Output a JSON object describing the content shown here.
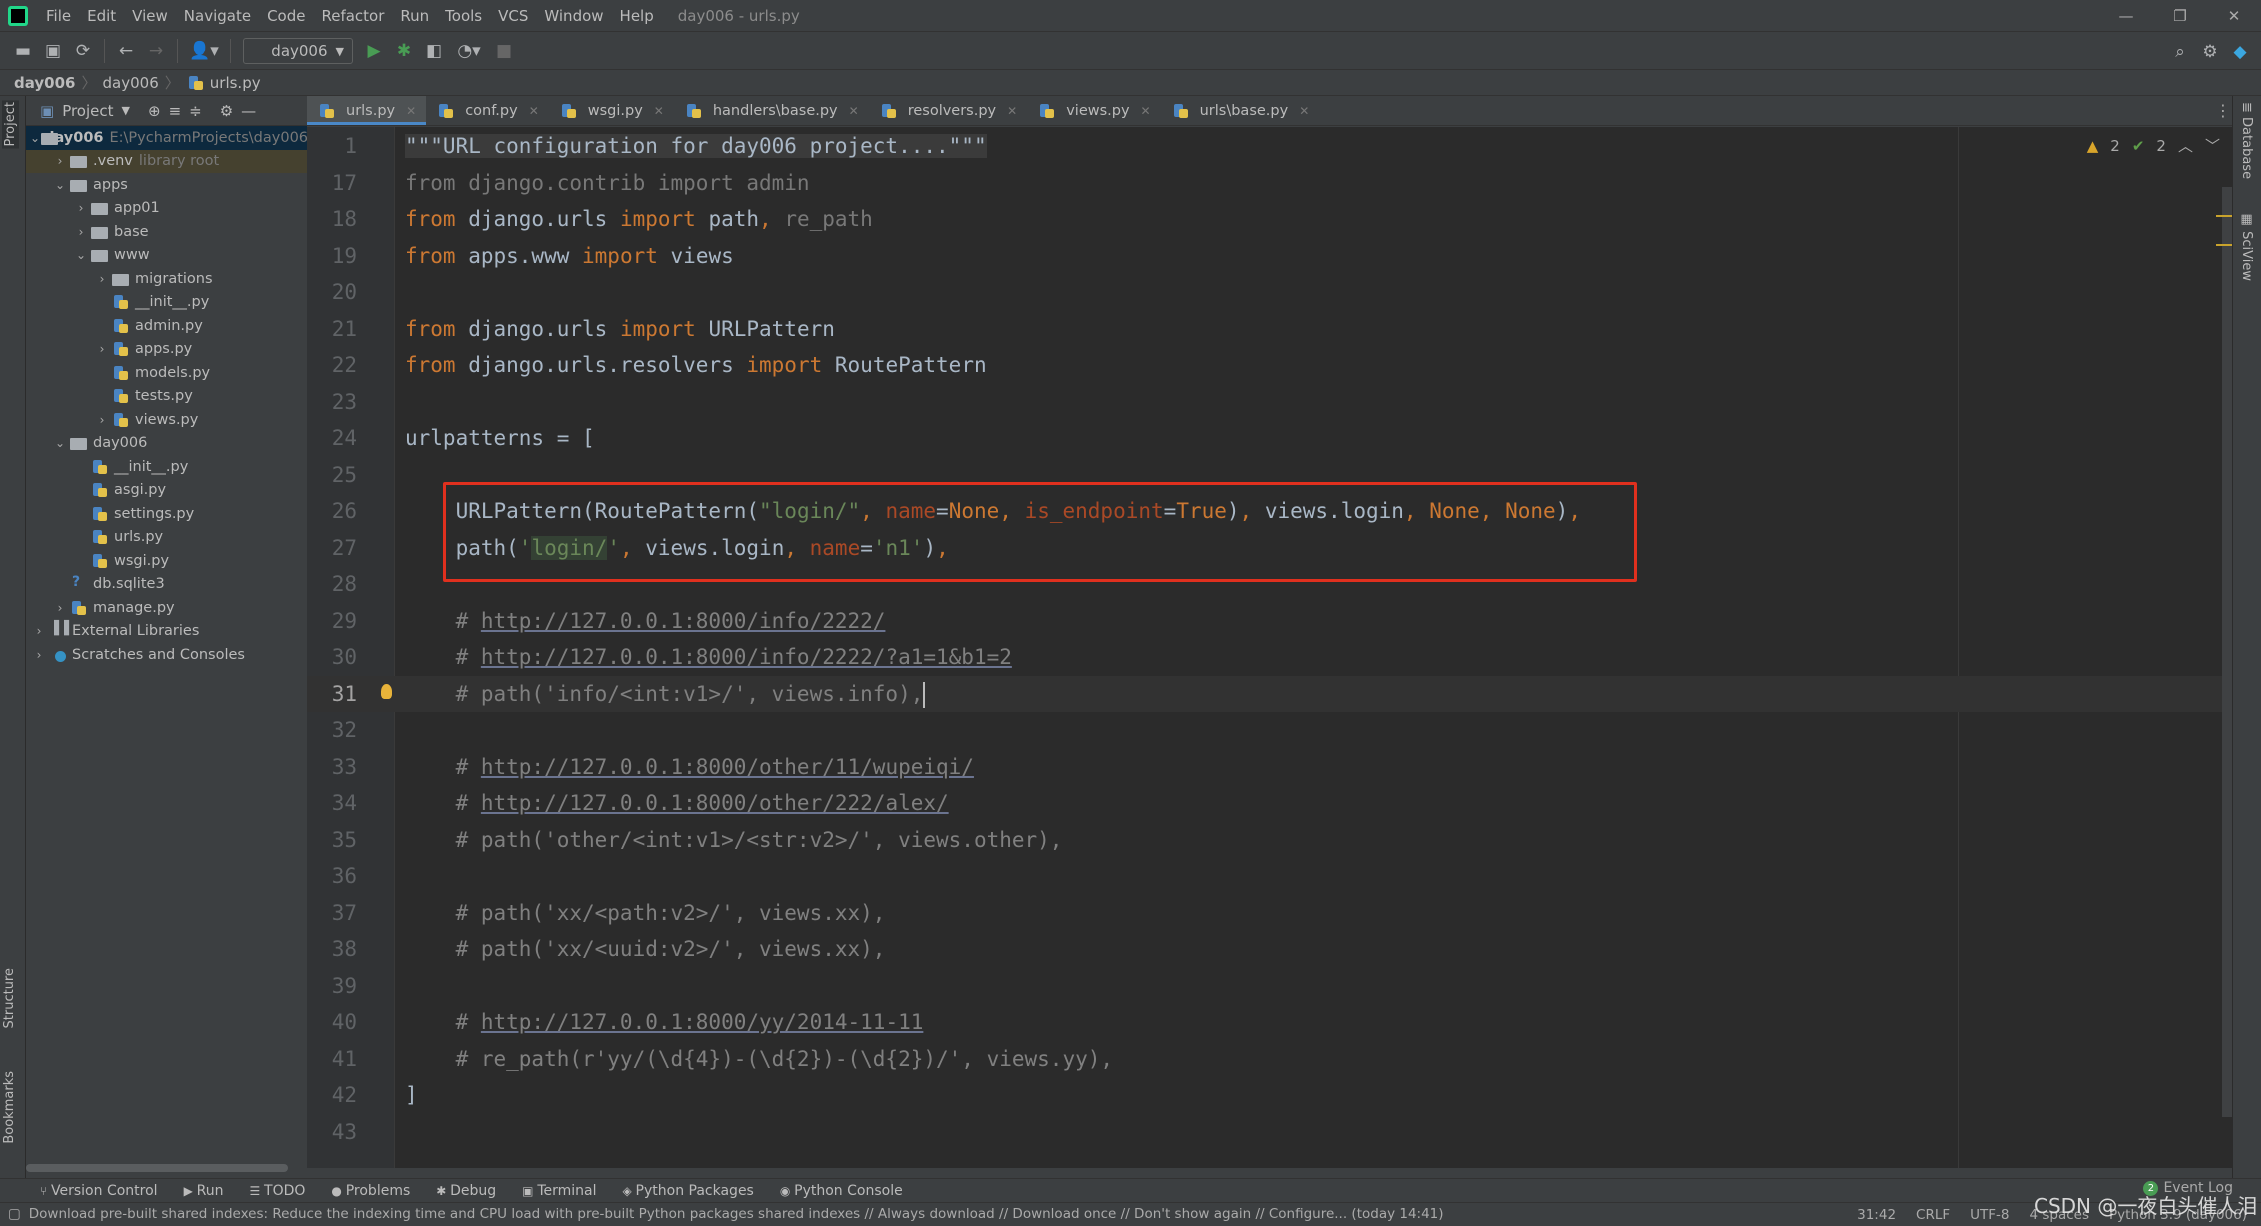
{
  "window": {
    "title": "day006 - urls.py",
    "controls": [
      "—",
      "❐",
      "✕"
    ]
  },
  "menu": [
    "File",
    "Edit",
    "View",
    "Navigate",
    "Code",
    "Refactor",
    "Run",
    "Tools",
    "VCS",
    "Window",
    "Help"
  ],
  "toolbar": {
    "run_config": "day006"
  },
  "breadcrumb": [
    "day006",
    "day006",
    "urls.py"
  ],
  "project_panel": {
    "title": "Project",
    "tree": [
      {
        "label": "day006",
        "hint": "E:\\PycharmProjects\\day006",
        "depth": 0,
        "arrow": "open",
        "icon": "folder",
        "state": "sel",
        "bold": true
      },
      {
        "label": ".venv",
        "hint": "library root",
        "depth": 1,
        "arrow": "closed",
        "icon": "folder",
        "state": "lib"
      },
      {
        "label": "apps",
        "depth": 1,
        "arrow": "open",
        "icon": "folder"
      },
      {
        "label": "app01",
        "depth": 2,
        "arrow": "closed",
        "icon": "folder"
      },
      {
        "label": "base",
        "depth": 2,
        "arrow": "closed",
        "icon": "folder"
      },
      {
        "label": "www",
        "depth": 2,
        "arrow": "open",
        "icon": "folder"
      },
      {
        "label": "migrations",
        "depth": 3,
        "arrow": "closed",
        "icon": "folder"
      },
      {
        "label": "__init__.py",
        "depth": 3,
        "arrow": "",
        "icon": "py"
      },
      {
        "label": "admin.py",
        "depth": 3,
        "arrow": "",
        "icon": "py"
      },
      {
        "label": "apps.py",
        "depth": 3,
        "arrow": "closed",
        "icon": "py"
      },
      {
        "label": "models.py",
        "depth": 3,
        "arrow": "",
        "icon": "py"
      },
      {
        "label": "tests.py",
        "depth": 3,
        "arrow": "",
        "icon": "py"
      },
      {
        "label": "views.py",
        "depth": 3,
        "arrow": "closed",
        "icon": "py"
      },
      {
        "label": "day006",
        "depth": 1,
        "arrow": "open",
        "icon": "folder"
      },
      {
        "label": "__init__.py",
        "depth": 2,
        "arrow": "",
        "icon": "py"
      },
      {
        "label": "asgi.py",
        "depth": 2,
        "arrow": "",
        "icon": "py"
      },
      {
        "label": "settings.py",
        "depth": 2,
        "arrow": "",
        "icon": "py"
      },
      {
        "label": "urls.py",
        "depth": 2,
        "arrow": "",
        "icon": "py"
      },
      {
        "label": "wsgi.py",
        "depth": 2,
        "arrow": "",
        "icon": "py"
      },
      {
        "label": "db.sqlite3",
        "depth": 1,
        "arrow": "",
        "icon": "db"
      },
      {
        "label": "manage.py",
        "depth": 1,
        "arrow": "closed",
        "icon": "py"
      },
      {
        "label": "External Libraries",
        "depth": 0,
        "arrow": "closed",
        "icon": "lib"
      },
      {
        "label": "Scratches and Consoles",
        "depth": 0,
        "arrow": "closed",
        "icon": "scratch"
      }
    ]
  },
  "tabs": [
    {
      "label": "urls.py",
      "active": true
    },
    {
      "label": "conf.py"
    },
    {
      "label": "wsgi.py"
    },
    {
      "label": "handlers\\base.py"
    },
    {
      "label": "resolvers.py"
    },
    {
      "label": "views.py"
    },
    {
      "label": "urls\\base.py"
    }
  ],
  "inspections": {
    "warnings": "2",
    "weak_warnings": "2"
  },
  "editor": {
    "lines": [
      {
        "n": "1",
        "tokens": [
          {
            "t": "\"\"\"URL configuration for day006 project....\"\"\"",
            "k": "fold"
          }
        ]
      },
      {
        "n": "17",
        "tokens": [
          {
            "t": "from django.contrib import admin",
            "k": "dim"
          }
        ]
      },
      {
        "n": "18",
        "tokens": [
          {
            "t": "from ",
            "k": "kw"
          },
          {
            "t": "django.urls "
          },
          {
            "t": "import ",
            "k": "kw"
          },
          {
            "t": "path"
          },
          {
            "t": ", ",
            "k": "kw"
          },
          {
            "t": "re_path",
            "k": "dim"
          }
        ]
      },
      {
        "n": "19",
        "tokens": [
          {
            "t": "from ",
            "k": "kw"
          },
          {
            "t": "apps.www "
          },
          {
            "t": "import ",
            "k": "kw"
          },
          {
            "t": "views"
          }
        ]
      },
      {
        "n": "20",
        "tokens": []
      },
      {
        "n": "21",
        "tokens": [
          {
            "t": "from ",
            "k": "kw"
          },
          {
            "t": "django.urls "
          },
          {
            "t": "import ",
            "k": "kw"
          },
          {
            "t": "URLPattern"
          }
        ]
      },
      {
        "n": "22",
        "tokens": [
          {
            "t": "from ",
            "k": "kw"
          },
          {
            "t": "django.urls.resolvers "
          },
          {
            "t": "import ",
            "k": "kw"
          },
          {
            "t": "RoutePattern"
          }
        ]
      },
      {
        "n": "23",
        "tokens": []
      },
      {
        "n": "24",
        "tokens": [
          {
            "t": "urlpatterns = ["
          }
        ]
      },
      {
        "n": "25",
        "tokens": []
      },
      {
        "n": "26",
        "tokens": [
          {
            "t": "    URLPattern(RoutePattern("
          },
          {
            "t": "\"login/\"",
            "k": "str"
          },
          {
            "t": ", ",
            "k": "kw"
          },
          {
            "t": "name",
            "k": "np"
          },
          {
            "t": "="
          },
          {
            "t": "None",
            "k": "kw"
          },
          {
            "t": ", ",
            "k": "kw"
          },
          {
            "t": "is_endpoint",
            "k": "np"
          },
          {
            "t": "="
          },
          {
            "t": "True",
            "k": "kw"
          },
          {
            "t": ")"
          },
          {
            "t": ", ",
            "k": "kw"
          },
          {
            "t": "views.login"
          },
          {
            "t": ", ",
            "k": "kw"
          },
          {
            "t": "None",
            "k": "kw"
          },
          {
            "t": ", ",
            "k": "kw"
          },
          {
            "t": "None",
            "k": "kw"
          },
          {
            "t": ")"
          },
          {
            "t": ",",
            "k": "kw"
          }
        ]
      },
      {
        "n": "27",
        "tokens": [
          {
            "t": "    path("
          },
          {
            "t": "'",
            "k": "str"
          },
          {
            "t": "login/",
            "k": "hlstr"
          },
          {
            "t": "'",
            "k": "str"
          },
          {
            "t": ", ",
            "k": "kw"
          },
          {
            "t": "views.login"
          },
          {
            "t": ", ",
            "k": "kw"
          },
          {
            "t": "name",
            "k": "np"
          },
          {
            "t": "="
          },
          {
            "t": "'n1'",
            "k": "str"
          },
          {
            "t": ")"
          },
          {
            "t": ",",
            "k": "kw"
          }
        ]
      },
      {
        "n": "28",
        "tokens": []
      },
      {
        "n": "29",
        "tokens": [
          {
            "t": "    # ",
            "k": "cm"
          },
          {
            "t": "http://127.0.0.1:8000/info/2222/",
            "k": "link"
          }
        ]
      },
      {
        "n": "30",
        "tokens": [
          {
            "t": "    # ",
            "k": "cm"
          },
          {
            "t": "http://127.0.0.1:8000/info/2222/?a1=1&b1=2",
            "k": "link"
          }
        ]
      },
      {
        "n": "31",
        "current": true,
        "tokens": [
          {
            "t": "    # path('info/<int:v1>/', views.info),",
            "k": "cm"
          }
        ]
      },
      {
        "n": "32",
        "tokens": []
      },
      {
        "n": "33",
        "tokens": [
          {
            "t": "    # ",
            "k": "cm"
          },
          {
            "t": "http://127.0.0.1:8000/other/11/wupeiqi/",
            "k": "link"
          }
        ]
      },
      {
        "n": "34",
        "tokens": [
          {
            "t": "    # ",
            "k": "cm"
          },
          {
            "t": "http://127.0.0.1:8000/other/222/alex/",
            "k": "link"
          }
        ]
      },
      {
        "n": "35",
        "tokens": [
          {
            "t": "    # path('other/<int:v1>/<str:v2>/', views.other),",
            "k": "cm"
          }
        ]
      },
      {
        "n": "36",
        "tokens": []
      },
      {
        "n": "37",
        "tokens": [
          {
            "t": "    # path('xx/<path:v2>/', views.xx),",
            "k": "cm"
          }
        ]
      },
      {
        "n": "38",
        "tokens": [
          {
            "t": "    # path('xx/<uuid:v2>/', views.xx),",
            "k": "cm"
          }
        ]
      },
      {
        "n": "39",
        "tokens": []
      },
      {
        "n": "40",
        "tokens": [
          {
            "t": "    # ",
            "k": "cm"
          },
          {
            "t": "http://127.0.0.1:8000/yy/2014-11-11",
            "k": "link"
          }
        ]
      },
      {
        "n": "41",
        "tokens": [
          {
            "t": "    # re_path(r'yy/(\\d{4})-(\\d{2})-(\\d{2})/', views.yy),",
            "k": "cm"
          }
        ]
      },
      {
        "n": "42",
        "tokens": [
          {
            "t": "]"
          }
        ]
      },
      {
        "n": "43",
        "tokens": []
      }
    ]
  },
  "side_tools": {
    "left": [
      "Project",
      "Structure",
      "Bookmarks"
    ],
    "right": [
      "Database",
      "SciView"
    ]
  },
  "bottom_tools": [
    "Version Control",
    "Run",
    "TODO",
    "Problems",
    "Debug",
    "Terminal",
    "Python Packages",
    "Python Console"
  ],
  "event_log": {
    "label": "Event Log",
    "count": "2"
  },
  "status": {
    "message": "Download pre-built shared indexes: Reduce the indexing time and CPU load with pre-built Python packages shared indexes // Always download // Download once // Don't show again // Configure... (today 14:41)",
    "position": "31:42",
    "line_sep": "CRLF",
    "encoding": "UTF-8",
    "indent": "4 spaces",
    "interpreter": "Python 3.9 (day006)"
  },
  "watermark": "CSDN @一夜白头催人泪",
  "colors": {
    "accent": "#4a88c7",
    "highlight_box": "#e0301e",
    "keyword": "#cc7832",
    "string": "#6a8759",
    "comment": "#808080"
  }
}
